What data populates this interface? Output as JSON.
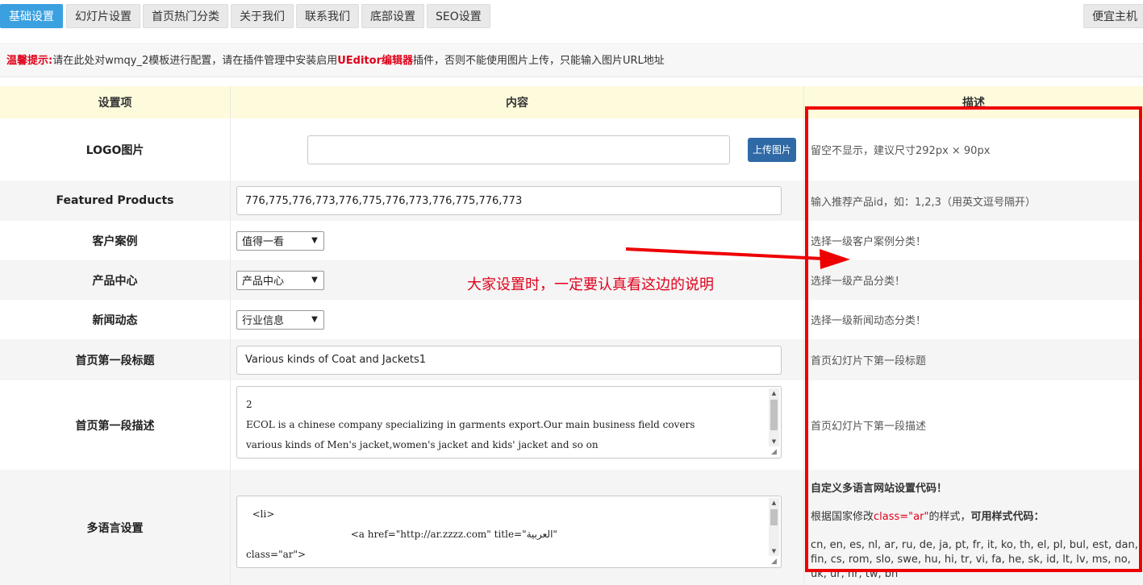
{
  "tabs": [
    {
      "label": "基础设置",
      "active": true
    },
    {
      "label": "幻灯片设置",
      "active": false
    },
    {
      "label": "首页热门分类",
      "active": false
    },
    {
      "label": "关于我们",
      "active": false
    },
    {
      "label": "联系我们",
      "active": false
    },
    {
      "label": "底部设置",
      "active": false
    },
    {
      "label": "SEO设置",
      "active": false
    }
  ],
  "host_button": "便宜主机",
  "notice": {
    "prefix": "温馨提示:",
    "text1": "请在此处对wmqy_2模板进行配置，请在插件管理中安装启用",
    "highlight": "UEditor编辑器",
    "text2": "插件，否则不能使用图片上传，只能输入图片URL地址"
  },
  "table_header": {
    "col1": "设置项",
    "col2": "内容",
    "col3": "描述"
  },
  "rows": {
    "logo": {
      "label": "LOGO图片",
      "value": "",
      "upload": "上传图片",
      "desc": "留空不显示，建议尺寸292px × 90px"
    },
    "featured": {
      "label": "Featured Products",
      "value": "776,775,776,773,776,775,776,773,776,775,776,773",
      "desc": "输入推荐产品id，如：1,2,3（用英文逗号隔开）"
    },
    "cases": {
      "label": "客户案例",
      "selected": "值得一看",
      "desc": "选择一级客户案例分类！"
    },
    "products": {
      "label": "产品中心",
      "selected": "产品中心",
      "desc": "选择一级产品分类！"
    },
    "news": {
      "label": "新闻动态",
      "selected": "行业信息",
      "desc": "选择一级新闻动态分类！"
    },
    "title1": {
      "label": "首页第一段标题",
      "value": "Various kinds of Coat and Jackets1",
      "desc": "首页幻灯片下第一段标题"
    },
    "desc1": {
      "label": "首页第一段描述",
      "lines": [
        "2",
        "ECOL is a chinese company specializing in garments export.Our main business field covers",
        "various kinds of Men's jacket,women's jacket and kids' jacket and so on"
      ],
      "desc": "首页幻灯片下第一段描述"
    },
    "lang": {
      "label": "多语言设置",
      "lines": [
        "  <li>",
        "                                  <a href=\"http://ar.zzzz.com\" title=\"العربية\"",
        "class=\"ar\">"
      ],
      "desc_title": "自定义多语言网站设置代码！",
      "desc_line_a": "根据国家修改",
      "desc_red": "class=\"ar\"",
      "desc_line_b": "的样式，",
      "desc_bold": "可用样式代码：",
      "desc_codes": "cn, en, es, nl, ar, ru, de, ja, pt, fr, it, ko, th, el, pl, bul, est, dan, fin, cs, rom, slo, swe, hu, hi, tr, vi, fa, he, sk, id, lt, lv, ms, no, uk, ur, hr, tw, bn"
    }
  },
  "annotation": {
    "text": "大家设置时，一定要认真看这边的说明",
    "color": "#e0001a"
  },
  "colors": {
    "accent": "#3aa0e0",
    "header_bg": "#fdfbdc",
    "upload_btn": "#2f6aa6",
    "annotation_red": "#ee0000"
  }
}
